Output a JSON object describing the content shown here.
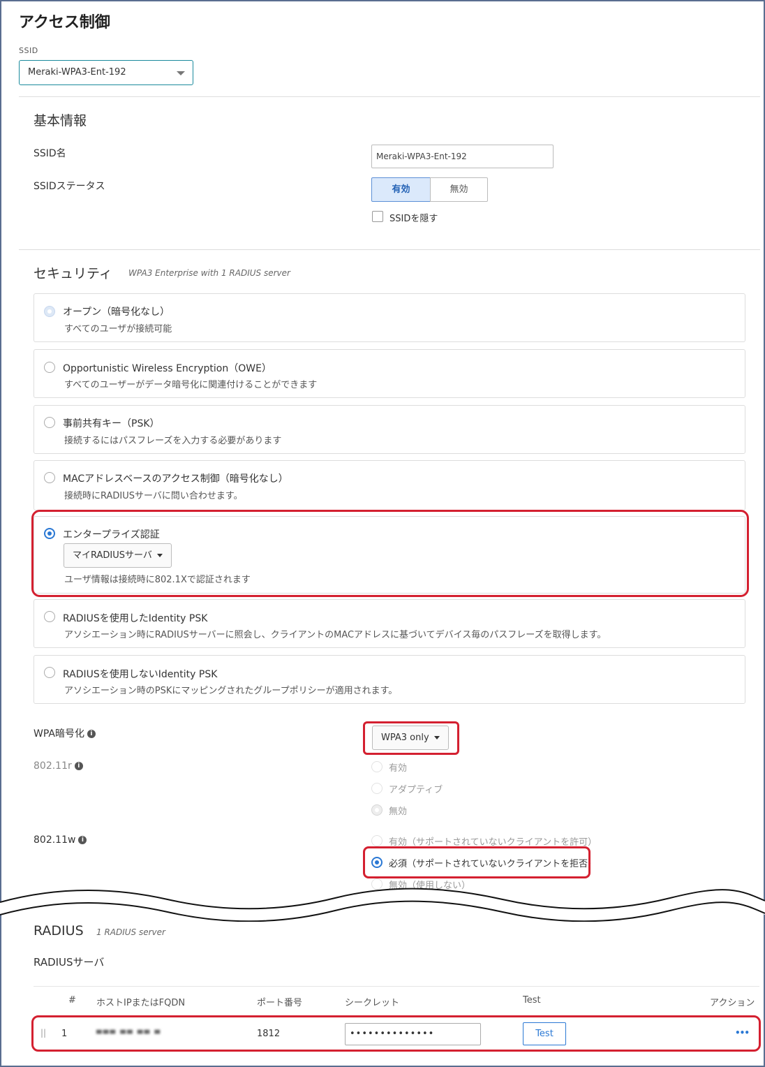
{
  "header": {
    "title": "アクセス制御",
    "ssid_label": "SSID",
    "ssid_selected": "Meraki-WPA3-Ent-192"
  },
  "basic": {
    "title": "基本情報",
    "ssid_name_label": "SSID名",
    "ssid_name_value": "Meraki-WPA3-Ent-192",
    "status_label": "SSIDステータス",
    "status_on": "有効",
    "status_off": "無効",
    "hide_ssid_label": "SSIDを隠す"
  },
  "security": {
    "title": "セキュリティ",
    "subtitle": "WPA3 Enterprise with 1 RADIUS server",
    "options": [
      {
        "title": "オープン（暗号化なし）",
        "desc": "すべてのユーザが接続可能"
      },
      {
        "title": "Opportunistic Wireless Encryption（OWE）",
        "desc": "すべてのユーザーがデータ暗号化に関連付けることができます"
      },
      {
        "title": "事前共有キー（PSK）",
        "desc": "接続するにはパスフレーズを入力する必要があります"
      },
      {
        "title": "MACアドレスベースのアクセス制御（暗号化なし）",
        "desc": "接続時にRADIUSサーバに問い合わせます。"
      },
      {
        "title": "エンタープライズ認証",
        "dropdown": "マイRADIUSサーバ",
        "desc": "ユーザ情報は接続時に802.1Xで認証されます"
      },
      {
        "title": "RADIUSを使用したIdentity PSK",
        "desc": "アソシエーション時にRADIUSサーバーに照会し、クライアントのMACアドレスに基づいてデバイス毎のパスフレーズを取得します。"
      },
      {
        "title": "RADIUSを使用しないIdentity PSK",
        "desc": "アソシエーション時のPSKにマッピングされたグループポリシーが適用されます。"
      }
    ],
    "wpa_label": "WPA暗号化",
    "wpa_value": "WPA3 only",
    "r_label": "802.11r",
    "r_options": [
      "有効",
      "アダプティブ",
      "無効"
    ],
    "w_label": "802.11w",
    "w_options": [
      "有効（サポートされていないクライアントを許可）",
      "必須（サポートされていないクライアントを拒否）",
      "無効（使用しない）"
    ]
  },
  "radius": {
    "title": "RADIUS",
    "subtitle": "1 RADIUS server",
    "servers_label": "RADIUSサーバ",
    "columns": [
      "#",
      "ホストIPまたはFQDN",
      "ポート番号",
      "シークレット",
      "Test",
      "アクション"
    ],
    "rows": [
      {
        "num": "1",
        "host": "▀▀▀ ▀▀ ▀▀ ▀",
        "port": "1812",
        "secret": "••••••••••••••",
        "test": "Test",
        "action": "•••"
      }
    ]
  },
  "colors": {
    "accent": "#2a78d4",
    "highlight": "#d42030"
  }
}
